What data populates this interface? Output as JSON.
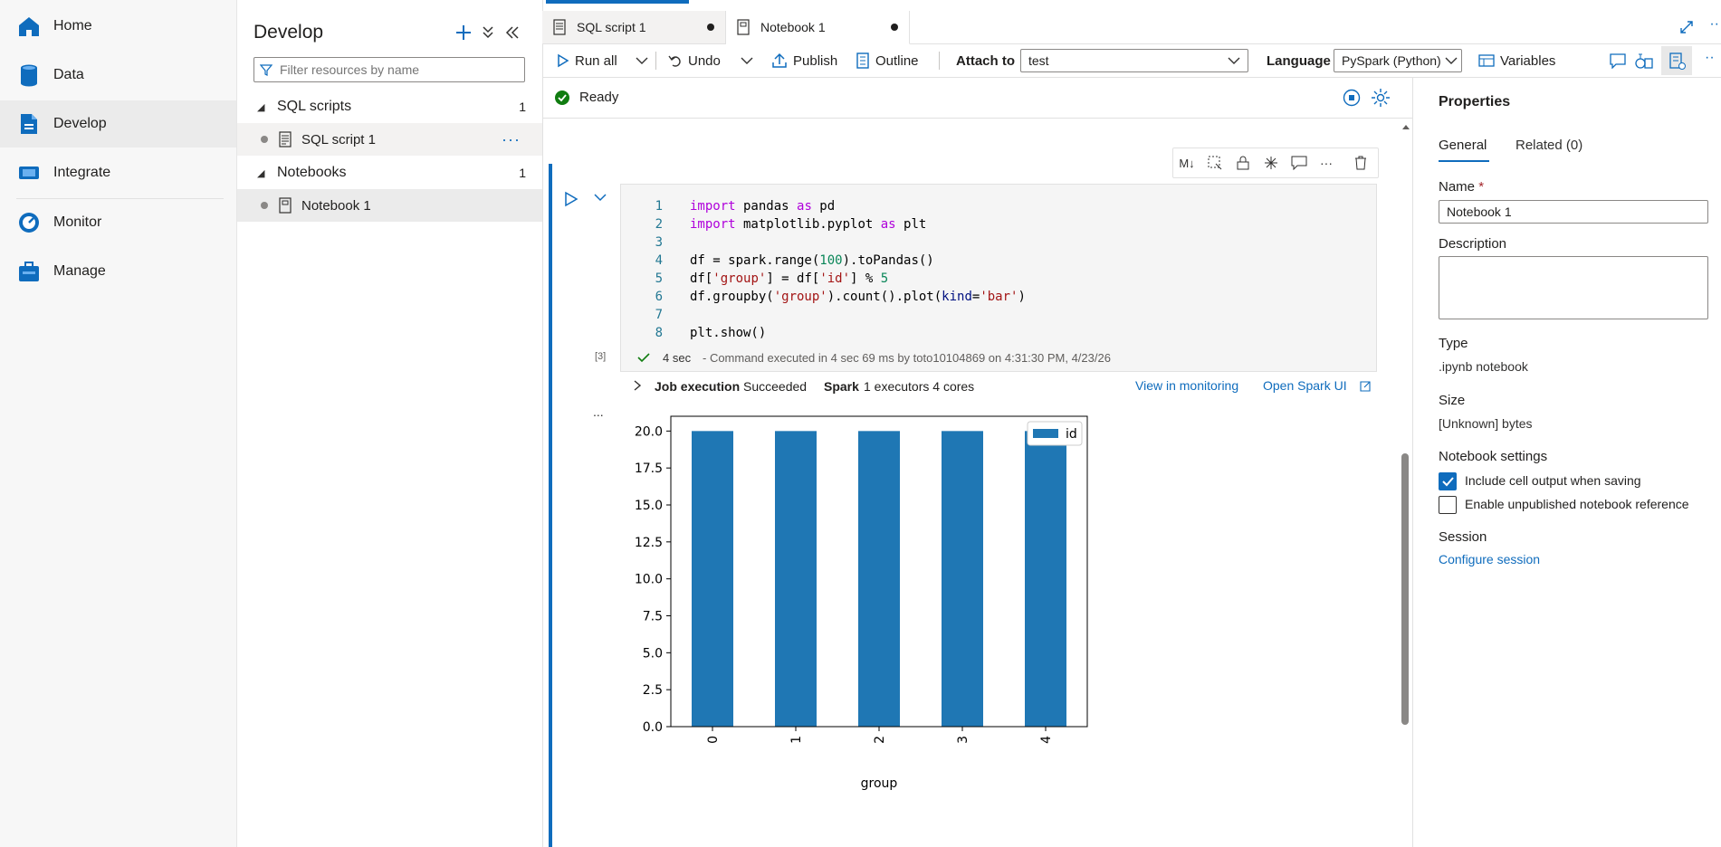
{
  "nav": {
    "items": [
      {
        "label": "Home",
        "icon": "home-icon"
      },
      {
        "label": "Data",
        "icon": "data-icon"
      },
      {
        "label": "Develop",
        "icon": "develop-icon"
      },
      {
        "label": "Integrate",
        "icon": "integrate-icon"
      },
      {
        "label": "Monitor",
        "icon": "monitor-icon"
      },
      {
        "label": "Manage",
        "icon": "manage-icon"
      }
    ],
    "active": "Develop"
  },
  "develop": {
    "title": "Develop",
    "filter_placeholder": "Filter resources by name",
    "sections": [
      {
        "label": "SQL scripts",
        "count": "1",
        "items": [
          {
            "label": "SQL script 1"
          }
        ]
      },
      {
        "label": "Notebooks",
        "count": "1",
        "items": [
          {
            "label": "Notebook 1"
          }
        ]
      }
    ]
  },
  "tabs": [
    {
      "label": "SQL script 1",
      "modified": true
    },
    {
      "label": "Notebook 1",
      "modified": true,
      "active": true
    }
  ],
  "toolbar": {
    "run_all": "Run all",
    "undo": "Undo",
    "publish": "Publish",
    "outline": "Outline",
    "attach_to_label": "Attach to",
    "attach_to_value": "test",
    "language_label": "Language",
    "language_value": "PySpark (Python)",
    "variables": "Variables"
  },
  "status": {
    "text": "Ready"
  },
  "cell": {
    "code_lines": [
      "import pandas as pd",
      "import matplotlib.pyplot as plt",
      "",
      "df = spark.range(100).toPandas()",
      "df['group'] = df['id'] % 5",
      "df.groupby('group').count().plot(kind='bar')",
      "",
      "plt.show()"
    ],
    "line_numbers": [
      "1",
      "2",
      "3",
      "4",
      "5",
      "6",
      "7",
      "8"
    ],
    "exec_count": "[3]",
    "exec_duration": "4 sec",
    "exec_message": "- Command executed in 4 sec 69 ms by toto10104869 on 4:31:30 PM, 4/23/26",
    "job_label": "Job execution",
    "job_status": "Succeeded",
    "spark_label": "Spark",
    "spark_info": "1 executors 4 cores",
    "view_monitoring": "View in monitoring",
    "open_spark_ui": "Open Spark UI",
    "output_more": "..."
  },
  "chart_data": {
    "type": "bar",
    "categories": [
      "0",
      "1",
      "2",
      "3",
      "4"
    ],
    "series": [
      {
        "name": "id",
        "values": [
          20,
          20,
          20,
          20,
          20
        ]
      }
    ],
    "xlabel": "group",
    "ylabel": "",
    "ylim": [
      0,
      21
    ],
    "yticks": [
      "0.0",
      "2.5",
      "5.0",
      "7.5",
      "10.0",
      "12.5",
      "15.0",
      "17.5",
      "20.0"
    ],
    "legend": "top-right",
    "color": "#1f77b4"
  },
  "properties": {
    "title": "Properties",
    "tab_general": "General",
    "tab_related": "Related (0)",
    "name_label": "Name",
    "name_required": "*",
    "name_value": "Notebook 1",
    "description_label": "Description",
    "type_label": "Type",
    "type_value": ".ipynb notebook",
    "size_label": "Size",
    "size_value": "[Unknown] bytes",
    "settings_label": "Notebook settings",
    "include_output": "Include cell output when saving",
    "include_output_checked": true,
    "enable_unpublished": "Enable unpublished notebook reference",
    "enable_unpublished_checked": false,
    "session_label": "Session",
    "configure_session": "Configure session"
  },
  "colors": {
    "accent": "#0f6cbd",
    "bar": "#1f77b4",
    "success": "#107c10"
  }
}
